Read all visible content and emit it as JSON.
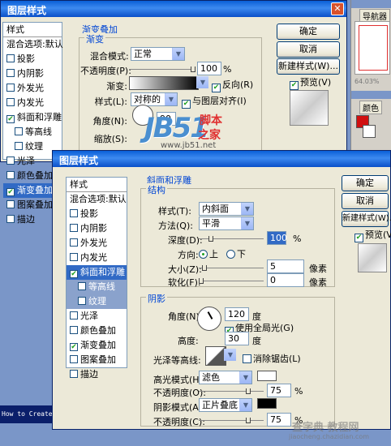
{
  "back_dialog": {
    "title": "图层样式",
    "style_list": {
      "header": "样式",
      "blend_options": "混合选项:默认",
      "items": [
        {
          "label": "投影",
          "checked": false
        },
        {
          "label": "内阴影",
          "checked": false
        },
        {
          "label": "外发光",
          "checked": false
        },
        {
          "label": "内发光",
          "checked": false
        },
        {
          "label": "斜面和浮雕",
          "checked": true
        },
        {
          "label": "等高线",
          "checked": false,
          "sub": true
        },
        {
          "label": "纹理",
          "checked": false,
          "sub": true
        },
        {
          "label": "光泽",
          "checked": false
        },
        {
          "label": "颜色叠加",
          "checked": false
        },
        {
          "label": "渐变叠加",
          "checked": true,
          "selected": true
        },
        {
          "label": "图案叠加",
          "checked": false
        },
        {
          "label": "描边",
          "checked": false
        }
      ]
    },
    "section_title": "渐变叠加",
    "group_title": "渐变",
    "blend_mode_label": "混合模式:",
    "blend_mode_value": "正常",
    "opacity_label": "不透明度(P):",
    "opacity_value": "100",
    "opacity_unit": "%",
    "gradient_label": "渐变:",
    "reverse_label": "反向(R)",
    "style_label": "样式(L):",
    "style_value": "对称的",
    "align_label": "与图层对齐(I)",
    "angle_label": "角度(N):",
    "angle_value": "90",
    "scale_label": "缩放(S):",
    "ok": "确定",
    "cancel": "取消",
    "new_style": "新建样式(W)...",
    "preview_label": "预览(V)"
  },
  "right_panel": {
    "navigator_tab": "导航器",
    "zoom": "64.03%",
    "color_tab": "颜色",
    "swatch_color": "#d01010"
  },
  "front_dialog": {
    "title": "图层样式",
    "style_list": {
      "header": "样式",
      "blend_options": "混合选项:默认",
      "items": [
        {
          "label": "投影",
          "checked": false
        },
        {
          "label": "内阴影",
          "checked": false
        },
        {
          "label": "外发光",
          "checked": false
        },
        {
          "label": "内发光",
          "checked": false
        },
        {
          "label": "斜面和浮雕",
          "checked": true,
          "selected": true
        },
        {
          "label": "等高线",
          "checked": false,
          "sub": true
        },
        {
          "label": "纹理",
          "checked": false,
          "sub": true
        },
        {
          "label": "光泽",
          "checked": false
        },
        {
          "label": "颜色叠加",
          "checked": false
        },
        {
          "label": "渐变叠加",
          "checked": true
        },
        {
          "label": "图案叠加",
          "checked": false
        },
        {
          "label": "描边",
          "checked": false
        }
      ]
    },
    "section_title": "斜面和浮雕",
    "structure_title": "结构",
    "style_label": "样式(T):",
    "style_value": "内斜面",
    "technique_label": "方法(Q):",
    "technique_value": "平滑",
    "depth_label": "深度(D):",
    "depth_value": "100",
    "pct": "%",
    "direction_label": "方向:",
    "dir_up": "上",
    "dir_down": "下",
    "size_label": "大小(Z):",
    "size_value": "5",
    "soften_label": "软化(F):",
    "soften_value": "0",
    "px": "像素",
    "shading_title": "阴影",
    "angle_label": "角度(N):",
    "angle_value": "120",
    "deg": "度",
    "global_light": "使用全局光(G)",
    "altitude_label": "高度:",
    "altitude_value": "30",
    "gloss_label": "光泽等高线:",
    "antialias": "消除锯齿(L)",
    "highlight_label": "高光模式(H):",
    "highlight_value": "滤色",
    "highlight_color": "#ffffff",
    "opacity1_label": "不透明度(O):",
    "opacity1_value": "75",
    "shadow_label": "阴影模式(A):",
    "shadow_value": "正片叠底",
    "shadow_color": "#000000",
    "opacity2_label": "不透明度(C):",
    "opacity2_value": "75",
    "ok": "确定",
    "cancel": "取消",
    "new_style": "新建样式(W)...",
    "preview_label": "预览(V)"
  },
  "watermark": {
    "logo": "JB51",
    "cn1": "脚本",
    "cn2": "之家",
    "url": "www.jb51.net",
    "bottom_cn": "查字典 教程网",
    "bottom_url": "jiaocheng.chazidian.com"
  },
  "status_text": "How to Create a"
}
